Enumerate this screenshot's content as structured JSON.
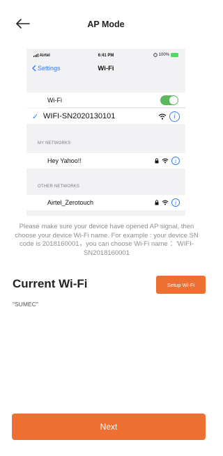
{
  "header": {
    "title": "AP Mode",
    "back_icon": "arrow-left-icon"
  },
  "screenshot": {
    "status_bar": {
      "carrier": "Airtel",
      "time": "6:41 PM",
      "battery": "100%"
    },
    "nav": {
      "back_label": "Settings",
      "title": "Wi-Fi"
    },
    "wifi_toggle": {
      "label": "Wi-Fi",
      "on": true
    },
    "connected": {
      "ssid": "WIFI-SN2020130101"
    },
    "my_networks": {
      "label": "MY NETWORKS",
      "items": [
        {
          "ssid": "Hey Yahoo!!"
        }
      ]
    },
    "other_networks": {
      "label": "OTHER NETWORKS",
      "items": [
        {
          "ssid": "Airtel_Zerotouch"
        }
      ]
    },
    "info_glyph": "i"
  },
  "instructions": "Please make sure your device have opened AP signal, then choose your device Wi-Fi name. For example : your device SN code is 2018160001，you can choose Wi-Fi name ：'WIFI-SN2018160001",
  "current_wifi": {
    "title": "Current Wi-Fi",
    "setup_label": "Setup Wi-Fi",
    "ssid": "\"SUMEC\""
  },
  "next_label": "Next",
  "colors": {
    "accent": "#ed7032",
    "ios_blue": "#2f7cf6",
    "toggle_green": "#5cb85c"
  }
}
